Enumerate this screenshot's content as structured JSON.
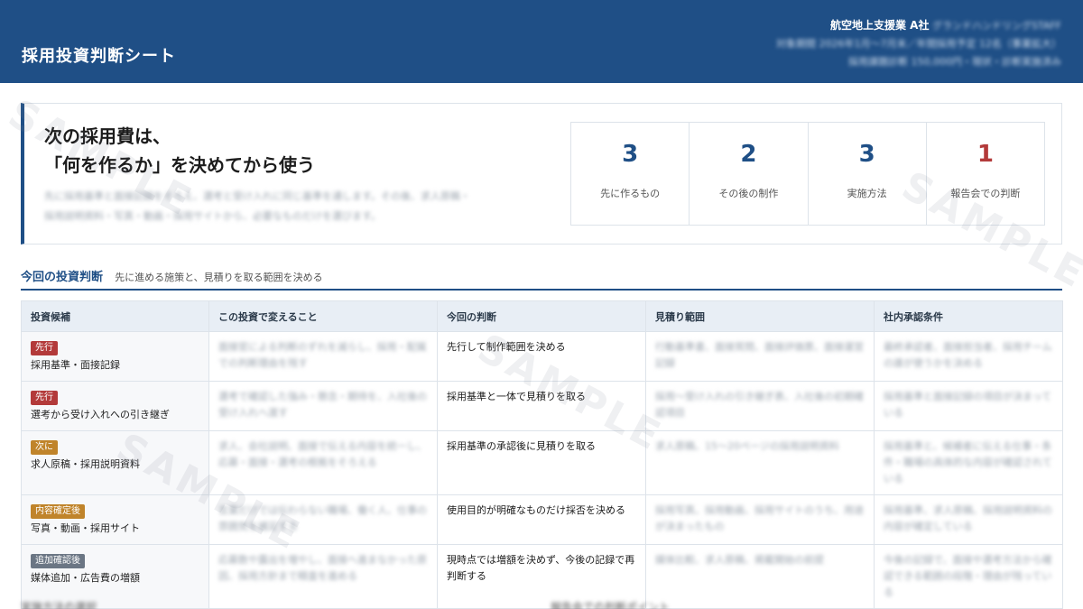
{
  "header": {
    "title": "採用投資判断シート",
    "company": "航空地上支援業 A社",
    "company_sub": "グランドハンドリングSTAFF",
    "meta_line2": "対象期間 2026年1月〜7月末／年間採用予定 12名（事業拡大）",
    "meta_line3": "採用課題診断 150,000円・現状・診断実施済み"
  },
  "hero": {
    "title_line1": "次の採用費は、",
    "title_line2": "「何を作るか」を決めてから使う",
    "desc_line1": "先に採用基準と面接記録をそろえ、選考と受け入れに同じ基準を通します。その後、求人原稿・",
    "desc_line2": "採用説明資料・写真・動画・採用サイトから、必要なものだけを選びます。"
  },
  "stats": [
    {
      "value": "3",
      "label": "先に作るもの",
      "color": "#1f4f86"
    },
    {
      "value": "2",
      "label": "その後の制作",
      "color": "#1f4f86"
    },
    {
      "value": "3",
      "label": "実施方法",
      "color": "#1f4f86"
    },
    {
      "value": "1",
      "label": "報告会での判断",
      "color": "#b33a3a"
    }
  ],
  "section": {
    "title": "今回の投資判断",
    "subtitle": "先に進める施策と、見積りを取る範囲を決める"
  },
  "table": {
    "headers": [
      "投資候補",
      "この投資で変えること",
      "今回の判断",
      "見積り範囲",
      "社内承認条件"
    ],
    "rows": [
      {
        "tag": "先行",
        "tag_color": "#b33a3a",
        "candidate": "採用基準・面接記録",
        "change": "面接官による判断のずれを減らし、採用・配属での判断理由を残す",
        "judgment": "先行して制作範囲を決める",
        "estimate": "行動基準書、面接質問、面接評価票、面接運営記録",
        "approval": "最終承認者、面接担当者、採用チームの誰が使うかを決める"
      },
      {
        "tag": "先行",
        "tag_color": "#b33a3a",
        "candidate": "選考から受け入れへの引き継ぎ",
        "change": "選考で確認した強み・懸念・期待を、入社後の受け入れへ渡す",
        "judgment": "採用基準と一体で見積りを取る",
        "estimate": "採用〜受け入れの引き継ぎ表、入社後の初期確認項目",
        "approval": "採用基準と面接記録の項目が決まっている"
      },
      {
        "tag": "次に",
        "tag_color": "#c0842a",
        "candidate": "求人原稿・採用説明資料",
        "change": "求人、会社説明、面接で伝える内容を統一し、応募・面接・選考の根拠をそろえる",
        "judgment": "採用基準の承認後に見積りを取る",
        "estimate": "求人原稿、15〜20ページの採用説明資料",
        "approval": "採用基準と、候補者に伝える仕事・条件・職場の具体的な内容が確認されている"
      },
      {
        "tag": "内容確定後",
        "tag_color": "#c0842a",
        "candidate": "写真・動画・採用サイト",
        "change": "言葉だけでは伝わらない職場、働く人、仕事の雰囲気を補足する",
        "judgment": "使用目的が明確なものだけ採否を決める",
        "estimate": "採用写真、採用動画、採用サイトのうち、用途が決まったもの",
        "approval": "採用基準、求人原稿、採用説明資料の内容が確定している"
      },
      {
        "tag": "追加確認後",
        "tag_color": "#6b7684",
        "candidate": "媒体追加・広告費の増額",
        "change": "応募数や露出を増やし、面接へ進まなかった原因、採用方針まで精査を進める",
        "judgment": "現時点では増額を決めず、今後の記録で再判断する",
        "estimate": "媒体比較、求人原稿、掲載開始の前提",
        "approval": "今後の記録で、面接や選考方法から確認できる範囲の段階・理由が残っている"
      }
    ]
  },
  "footer": {
    "left": "実施方法の選択",
    "right": "報告会での判断ポイント"
  },
  "watermark": "SAMPLE"
}
